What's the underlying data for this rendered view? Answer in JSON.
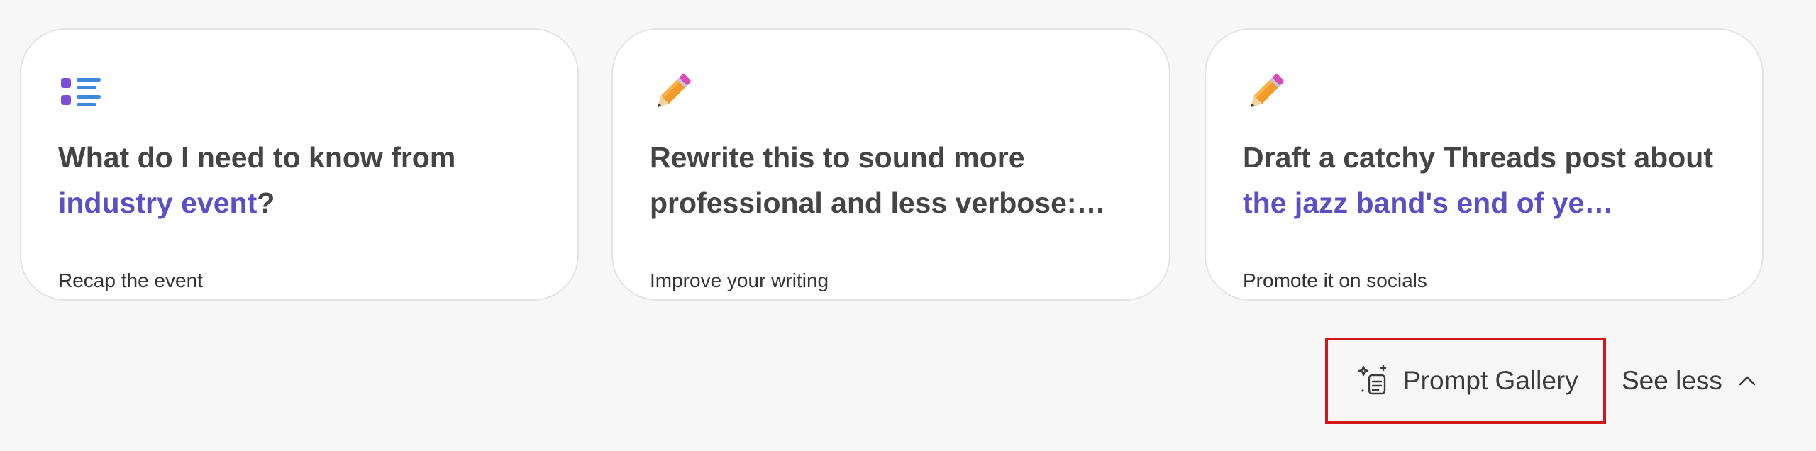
{
  "cards": [
    {
      "icon": "list-icon",
      "prompt_parts": [
        "What do I need to know from ",
        "industry event",
        "?"
      ],
      "caption": "Recap the event"
    },
    {
      "icon": "pencil-icon",
      "prompt_parts": [
        "Rewrite this to sound more professional and less verbose:…"
      ],
      "caption": "Improve your writing"
    },
    {
      "icon": "pencil-icon",
      "prompt_parts": [
        "Draft a catchy Threads post about ",
        "the jazz band's end of ye…"
      ],
      "caption": "Promote it on socials"
    }
  ],
  "actions": {
    "prompt_gallery_label": "Prompt Gallery",
    "prompt_gallery_icon": "prompt-gallery-icon",
    "see_less_label": "See less",
    "see_less_icon": "chevron-up-icon"
  },
  "colors": {
    "highlight": "#5a4fc4",
    "focus_outline": "#d2161c",
    "background": "#f7f7f7"
  }
}
